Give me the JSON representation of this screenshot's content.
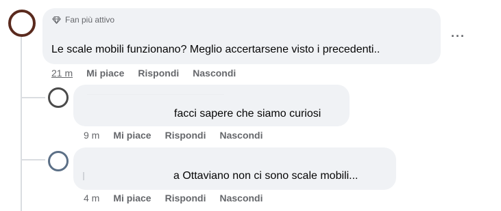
{
  "comment1": {
    "badge": "Fan più attivo",
    "badge_icon": "diamond-icon",
    "text": "Le scale mobili funzionano? Meglio accertarsene visto i precedenti..",
    "time": "21 m",
    "like_label": "Mi piace",
    "reply_label": "Rispondi",
    "hide_label": "Nascondi",
    "more_label": "···"
  },
  "reply1": {
    "text": "facci sapere che siamo curiosi",
    "time": "9 m",
    "like_label": "Mi piace",
    "reply_label": "Rispondi",
    "hide_label": "Nascondi"
  },
  "reply2": {
    "text": "a Ottaviano non ci sono scale mobili...",
    "time": "4 m",
    "like_label": "Mi piace",
    "reply_label": "Rispondi",
    "hide_label": "Nascondi"
  }
}
